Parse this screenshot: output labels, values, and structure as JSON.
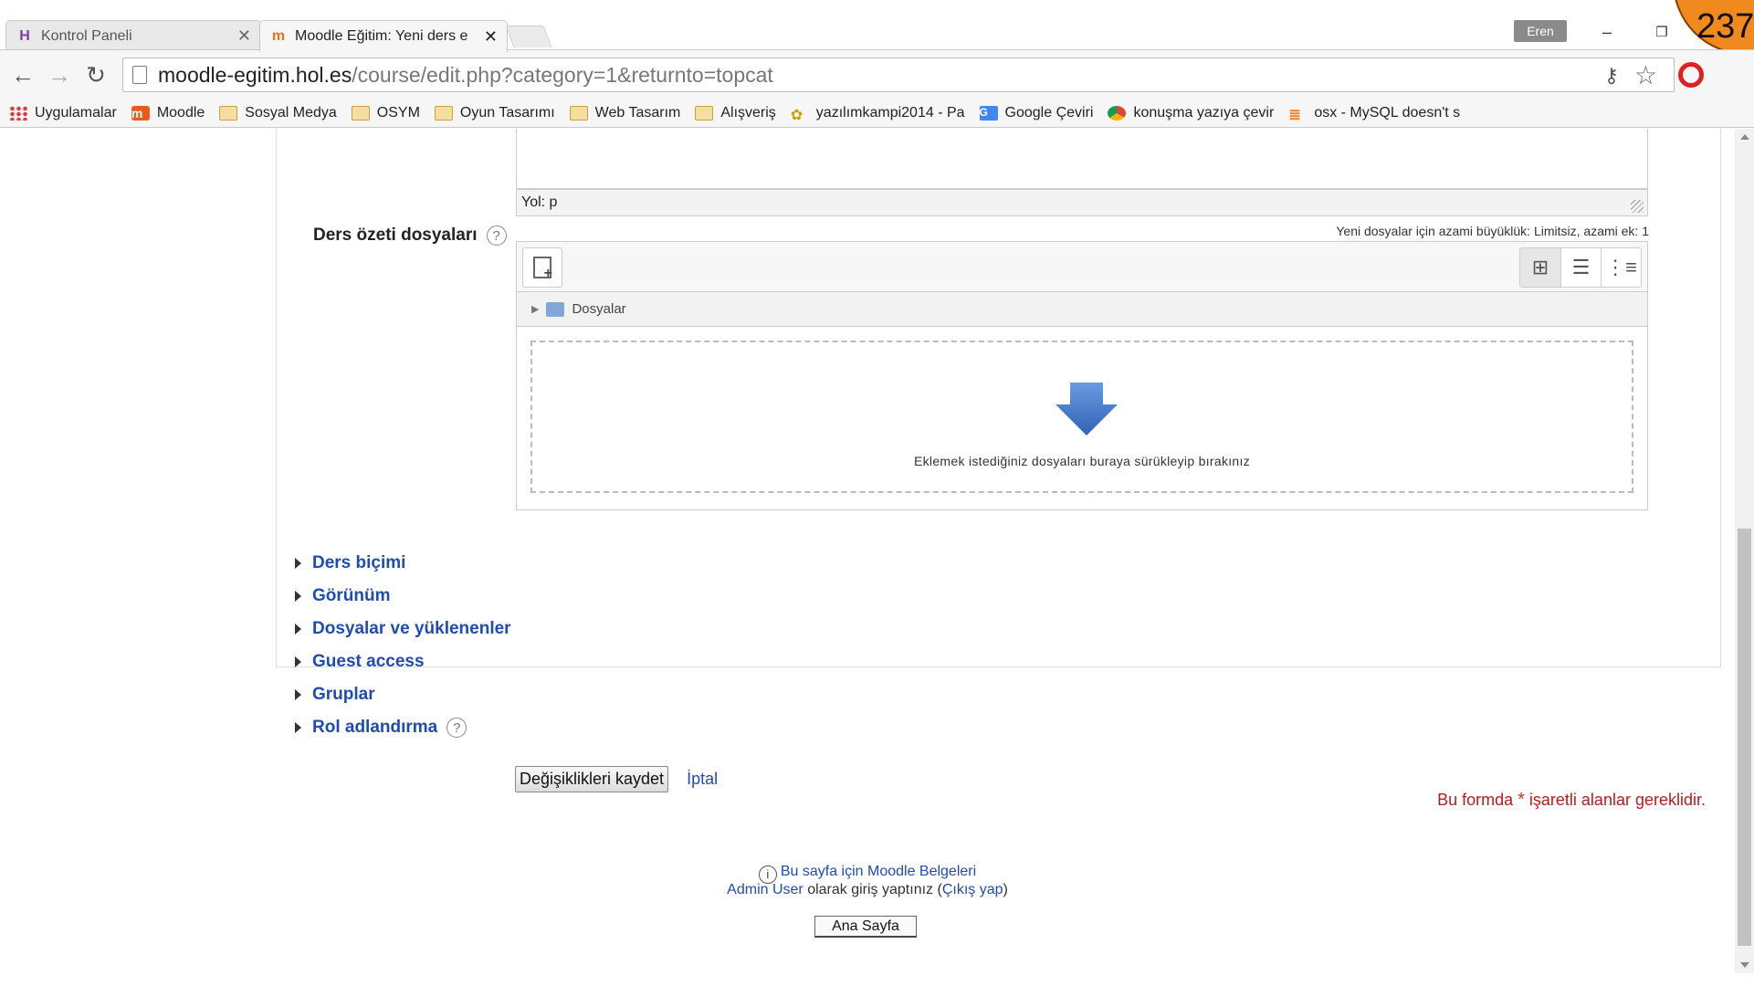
{
  "tabs": [
    {
      "title": "Kontrol Paneli",
      "active": false
    },
    {
      "title": "Moodle Eğitim: Yeni ders e",
      "active": true
    }
  ],
  "window": {
    "profile": "Eren",
    "overlay_badge": "237"
  },
  "omnibox": {
    "host": "moodle-egitim.hol.es",
    "path": "/course/edit.php?category=1&returnto=topcat"
  },
  "bookmarks": [
    {
      "label": "Uygulamalar",
      "icon": "apps-icon"
    },
    {
      "label": "Moodle",
      "icon": "moodle-icon"
    },
    {
      "label": "Sosyal Medya",
      "icon": "folder-icon"
    },
    {
      "label": "OSYM",
      "icon": "folder-icon"
    },
    {
      "label": "Oyun Tasarımı",
      "icon": "folder-icon"
    },
    {
      "label": "Web Tasarım",
      "icon": "folder-icon"
    },
    {
      "label": "Alışveriş",
      "icon": "folder-icon"
    },
    {
      "label": "yazılımkampi2014 - Pa",
      "icon": "paw-icon"
    },
    {
      "label": "Google Çeviri",
      "icon": "google-translate-icon"
    },
    {
      "label": "konuşma yazıya çevir",
      "icon": "chrome-icon"
    },
    {
      "label": "osx - MySQL doesn't s",
      "icon": "stackoverflow-icon"
    }
  ],
  "editor": {
    "path_label": "Yol: p"
  },
  "files_field": {
    "label": "Ders özeti dosyaları",
    "max_size_note": "Yeni dosyalar için azami büyüklük: Limitsiz, azami ek: 1",
    "folder_label": "Dosyalar",
    "drop_text": "Eklemek istediğiniz dosyaları buraya sürükleyip bırakınız"
  },
  "sections": [
    {
      "label": "Ders biçimi",
      "help": false
    },
    {
      "label": "Görünüm",
      "help": false
    },
    {
      "label": "Dosyalar ve yüklenenler",
      "help": false
    },
    {
      "label": "Guest access",
      "help": false
    },
    {
      "label": "Gruplar",
      "help": false
    },
    {
      "label": "Rol adlandırma",
      "help": true
    }
  ],
  "actions": {
    "save": "Değişiklikleri kaydet",
    "cancel": "İptal"
  },
  "required_note": {
    "before": "Bu formda ",
    "marker": "*",
    "after": " işaretli alanlar gereklidir."
  },
  "footer": {
    "docs_link": "Bu sayfa için Moodle Belgeleri",
    "user_link": "Admin User",
    "logged_in_text": " olarak giriş yaptınız (",
    "logout_link": "Çıkış yap",
    "close_paren": ")",
    "home_button": "Ana Sayfa"
  },
  "colors": {
    "link": "#1f4bb5",
    "required": "#b71c1c",
    "accent_badge": "#f08a1e"
  }
}
